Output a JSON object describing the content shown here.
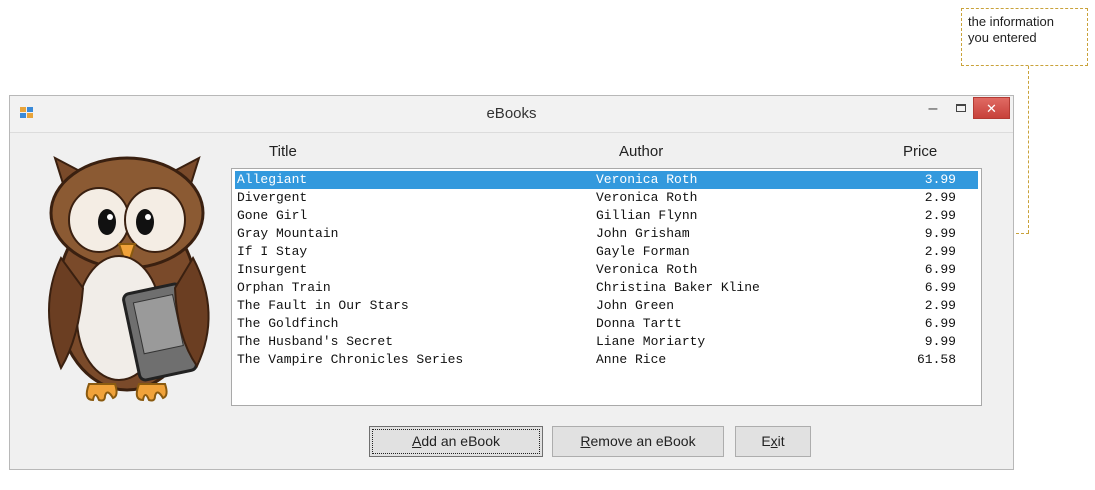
{
  "callout": {
    "text_line1": "the information",
    "text_line2": "you entered"
  },
  "window": {
    "title": "eBooks",
    "controls": {
      "minimize": "–",
      "close": "✕"
    }
  },
  "columns": {
    "title": "Title",
    "author": "Author",
    "price": "Price"
  },
  "books": [
    {
      "title": "Allegiant",
      "author": "Veronica Roth",
      "price": "3.99",
      "selected": true
    },
    {
      "title": "Divergent",
      "author": "Veronica Roth",
      "price": "2.99"
    },
    {
      "title": "Gone Girl",
      "author": "Gillian Flynn",
      "price": "2.99"
    },
    {
      "title": "Gray Mountain",
      "author": "John Grisham",
      "price": "9.99"
    },
    {
      "title": "If I Stay",
      "author": "Gayle Forman",
      "price": "2.99"
    },
    {
      "title": "Insurgent",
      "author": "Veronica Roth",
      "price": "6.99"
    },
    {
      "title": "Orphan Train",
      "author": "Christina Baker Kline",
      "price": "6.99"
    },
    {
      "title": "The Fault in Our Stars",
      "author": "John Green",
      "price": "2.99"
    },
    {
      "title": "The Goldfinch",
      "author": "Donna Tartt",
      "price": "6.99"
    },
    {
      "title": "The Husband's Secret",
      "author": "Liane Moriarty",
      "price": "9.99"
    },
    {
      "title": "The Vampire Chronicles Series",
      "author": "Anne Rice",
      "price": "61.58"
    }
  ],
  "buttons": {
    "add": {
      "accel": "A",
      "rest": "dd an eBook"
    },
    "remove": {
      "accel": "R",
      "rest": "emove an eBook"
    },
    "exit": {
      "pre": "E",
      "accel": "x",
      "rest": "it"
    }
  },
  "icons": {
    "owl": "owl-reading-ebook-icon",
    "app": "app-window-icon"
  },
  "colors": {
    "selection": "#3399dd",
    "close_button": "#c7413a",
    "callout_border": "#c9a23a"
  }
}
